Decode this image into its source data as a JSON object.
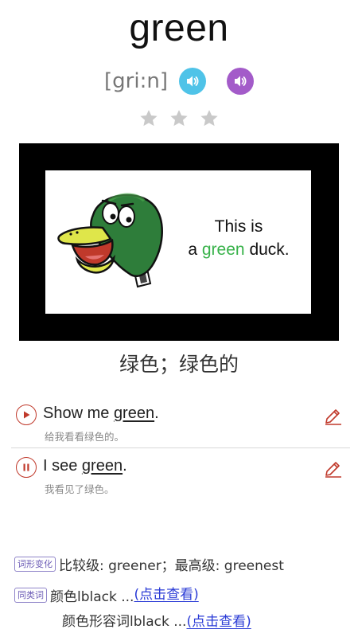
{
  "word": "green",
  "phonetic": "[gri:n]",
  "speakers": {
    "uk": "speaker-icon",
    "us": "speaker-icon"
  },
  "stars": {
    "filled": 0,
    "total": 3
  },
  "card": {
    "line1": "This is",
    "line2_a": "a",
    "line2_word": "green",
    "line2_b": "duck."
  },
  "meaning": "绿色；绿色的",
  "sentences": [
    {
      "en_before": "Show me ",
      "en_word": "green",
      "en_after": ".",
      "zh": "给我看看绿色的。"
    },
    {
      "en_before": "I see ",
      "en_word": "green",
      "en_after": ".",
      "zh": "我看见了绿色。"
    }
  ],
  "inflection": {
    "tag": "词形变化",
    "text": "比较级: greener；最高级: greenest"
  },
  "synonyms": {
    "tag": "同类词",
    "row1_text": "颜色lblack ...",
    "row1_link": "(点击查看)",
    "row2_text": "颜色形容词lblack ...",
    "row2_link": "(点击查看)"
  },
  "colors": {
    "highlight_green": "#38b24a",
    "accent_red": "#c0392b",
    "link_blue": "#2a3bd6",
    "tag_purple": "#6b5bb5"
  }
}
